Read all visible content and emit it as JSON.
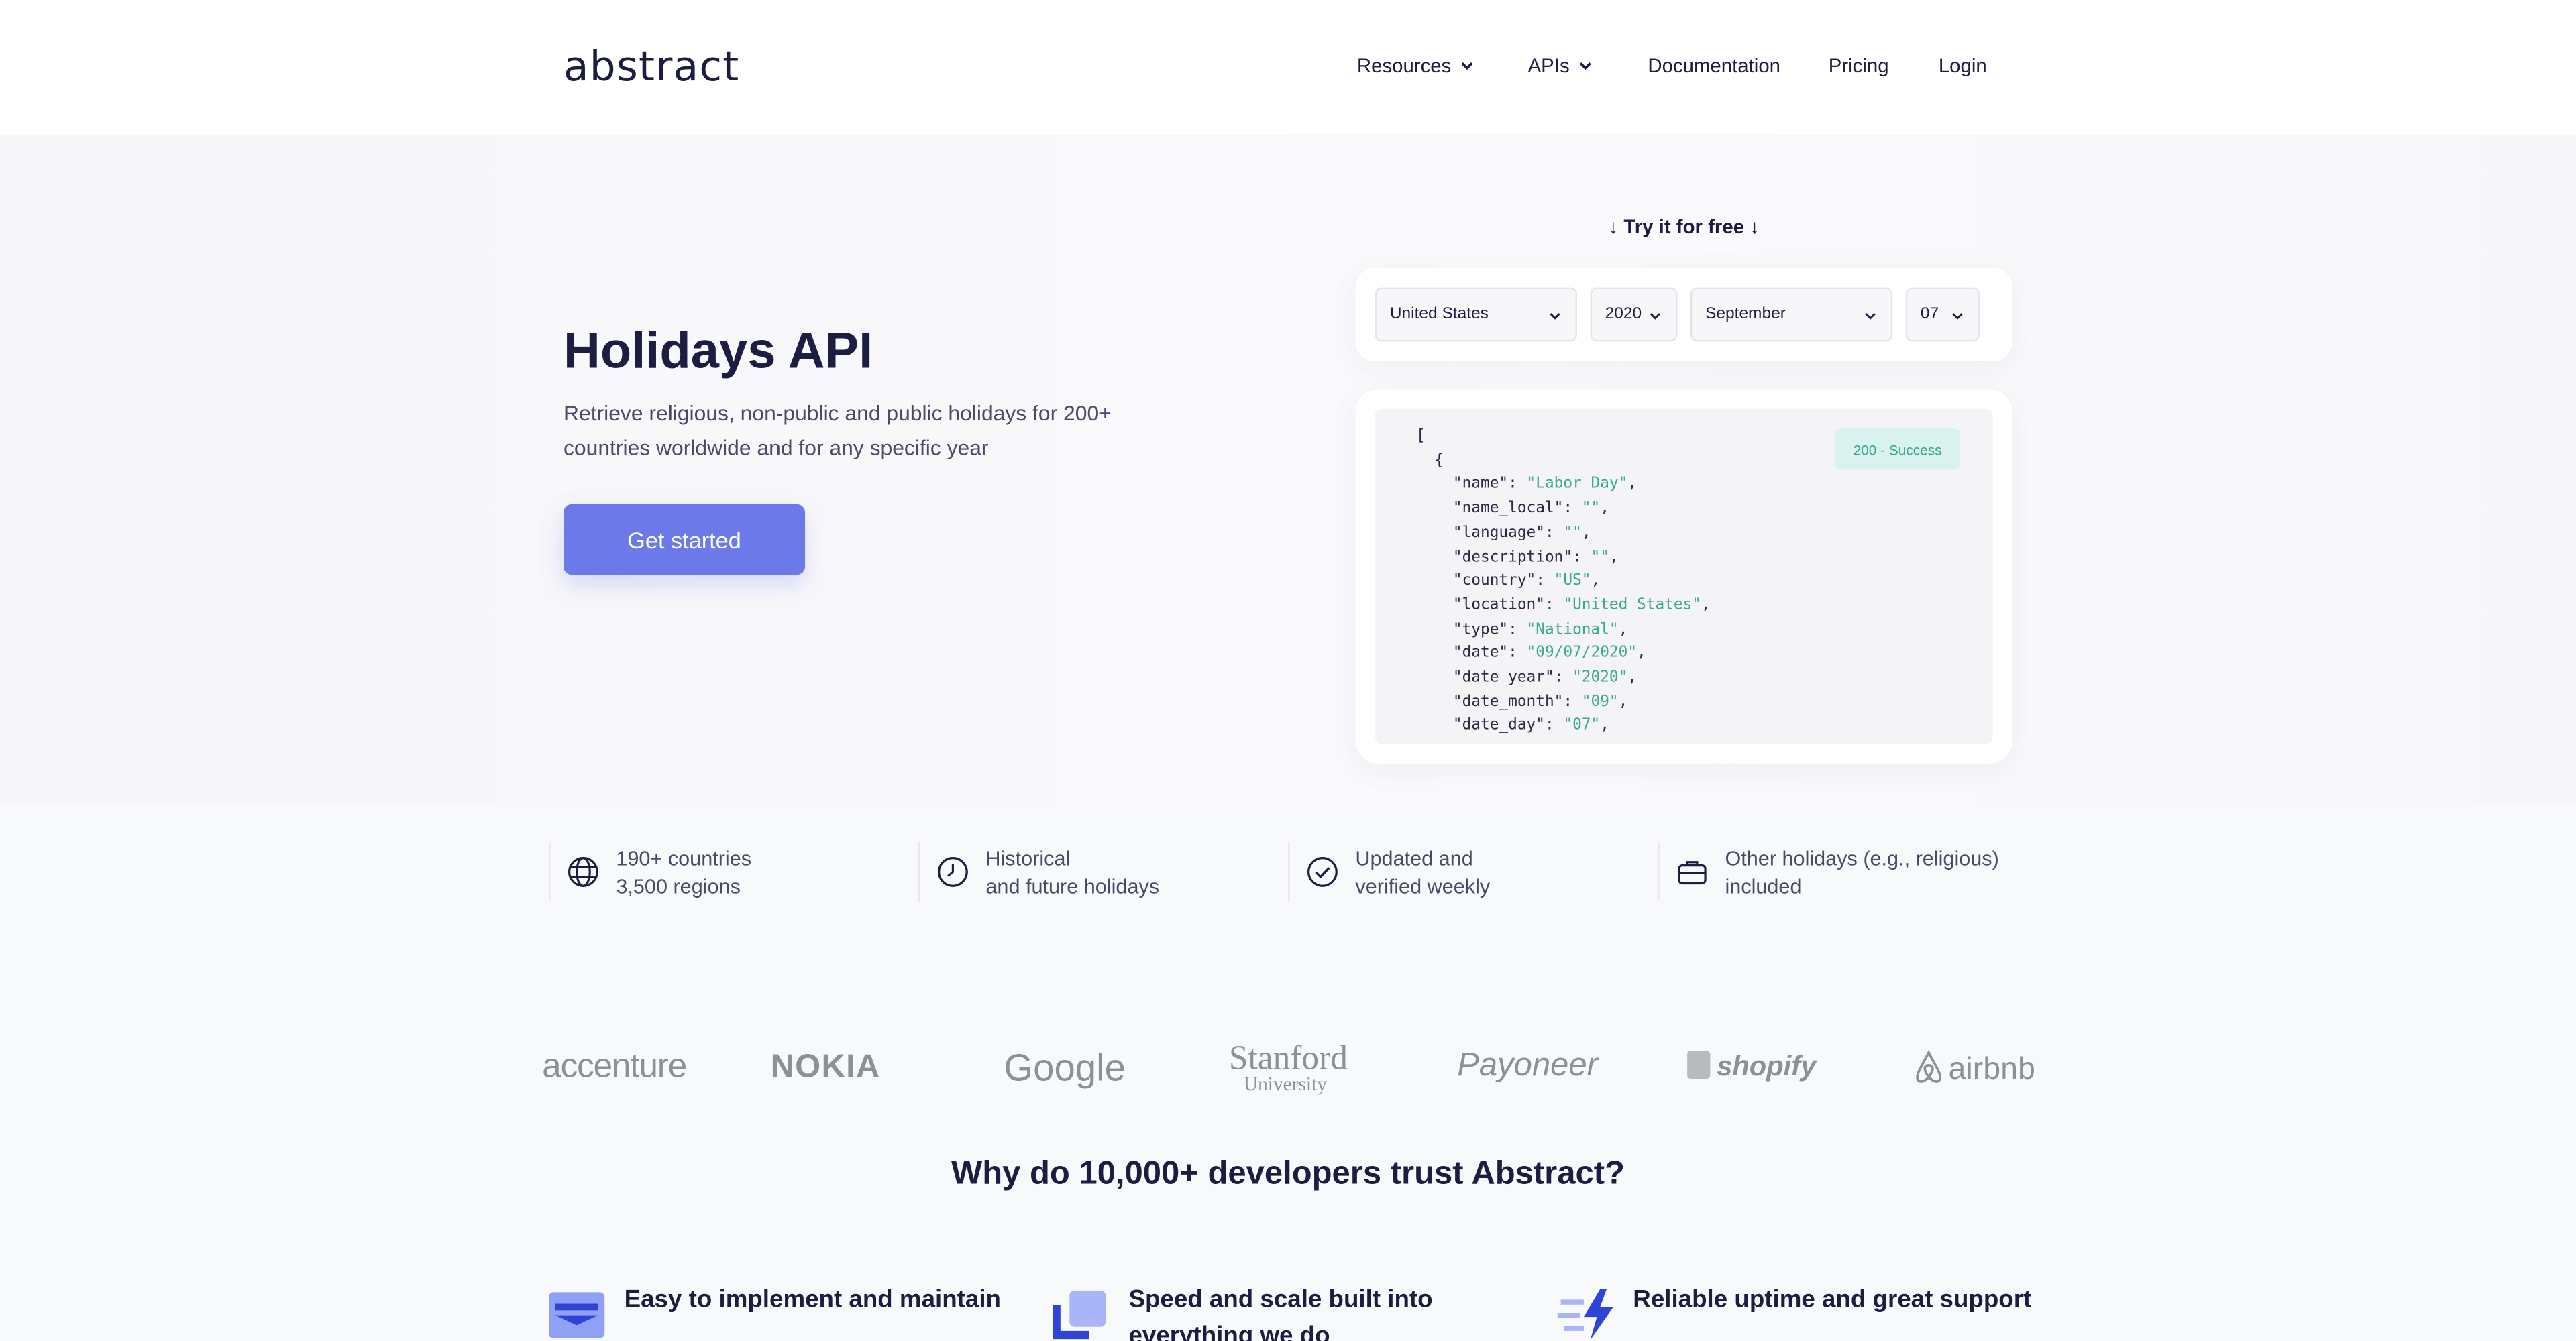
{
  "header": {
    "logo": "abstract",
    "nav": [
      {
        "label": "Resources",
        "dropdown": true
      },
      {
        "label": "APIs",
        "dropdown": true
      },
      {
        "label": "Documentation",
        "dropdown": false
      },
      {
        "label": "Pricing",
        "dropdown": false
      },
      {
        "label": "Login",
        "dropdown": false
      }
    ]
  },
  "hero": {
    "title": "Holidays API",
    "subtitle": "Retrieve religious, non-public and public holidays for 200+ countries worldwide and for any specific year",
    "cta_label": "Get started"
  },
  "demo": {
    "try_label": "↓ Try it for free ↓",
    "selects": {
      "country": "United States",
      "year": "2020",
      "month": "September",
      "day": "07"
    },
    "status_badge": "200 - Success",
    "response": [
      {
        "key": "name",
        "value": "Labor Day"
      },
      {
        "key": "name_local",
        "value": ""
      },
      {
        "key": "language",
        "value": ""
      },
      {
        "key": "description",
        "value": ""
      },
      {
        "key": "country",
        "value": "US"
      },
      {
        "key": "location",
        "value": "United States"
      },
      {
        "key": "type",
        "value": "National"
      },
      {
        "key": "date",
        "value": "09/07/2020"
      },
      {
        "key": "date_year",
        "value": "2020"
      },
      {
        "key": "date_month",
        "value": "09"
      },
      {
        "key": "date_day",
        "value": "07"
      }
    ]
  },
  "features": [
    {
      "icon": "globe-icon",
      "line1": "190+ countries",
      "line2": "3,500 regions"
    },
    {
      "icon": "clock-icon",
      "line1": "Historical",
      "line2": "and future holidays"
    },
    {
      "icon": "check-circle-icon",
      "line1": "Updated and",
      "line2": "verified weekly"
    },
    {
      "icon": "briefcase-icon",
      "line1": "Other holidays (e.g., religious)",
      "line2": "included"
    }
  ],
  "logos": [
    "accenture",
    "NOKIA",
    "Google",
    "Stanford",
    "University",
    "Payoneer",
    "shopify",
    "airbnb"
  ],
  "why_title": "Why do 10,000+ developers trust Abstract?",
  "benefits": [
    {
      "icon": "layers-icon",
      "title": "Easy to implement and maintain"
    },
    {
      "icon": "stack-icon",
      "title": "Speed and scale built into everything we do"
    },
    {
      "icon": "lightning-icon",
      "title": "Reliable uptime and great support"
    }
  ],
  "colors": {
    "accent": "#6b7ae8",
    "text": "#1d1d42",
    "success": "#33a58c"
  }
}
